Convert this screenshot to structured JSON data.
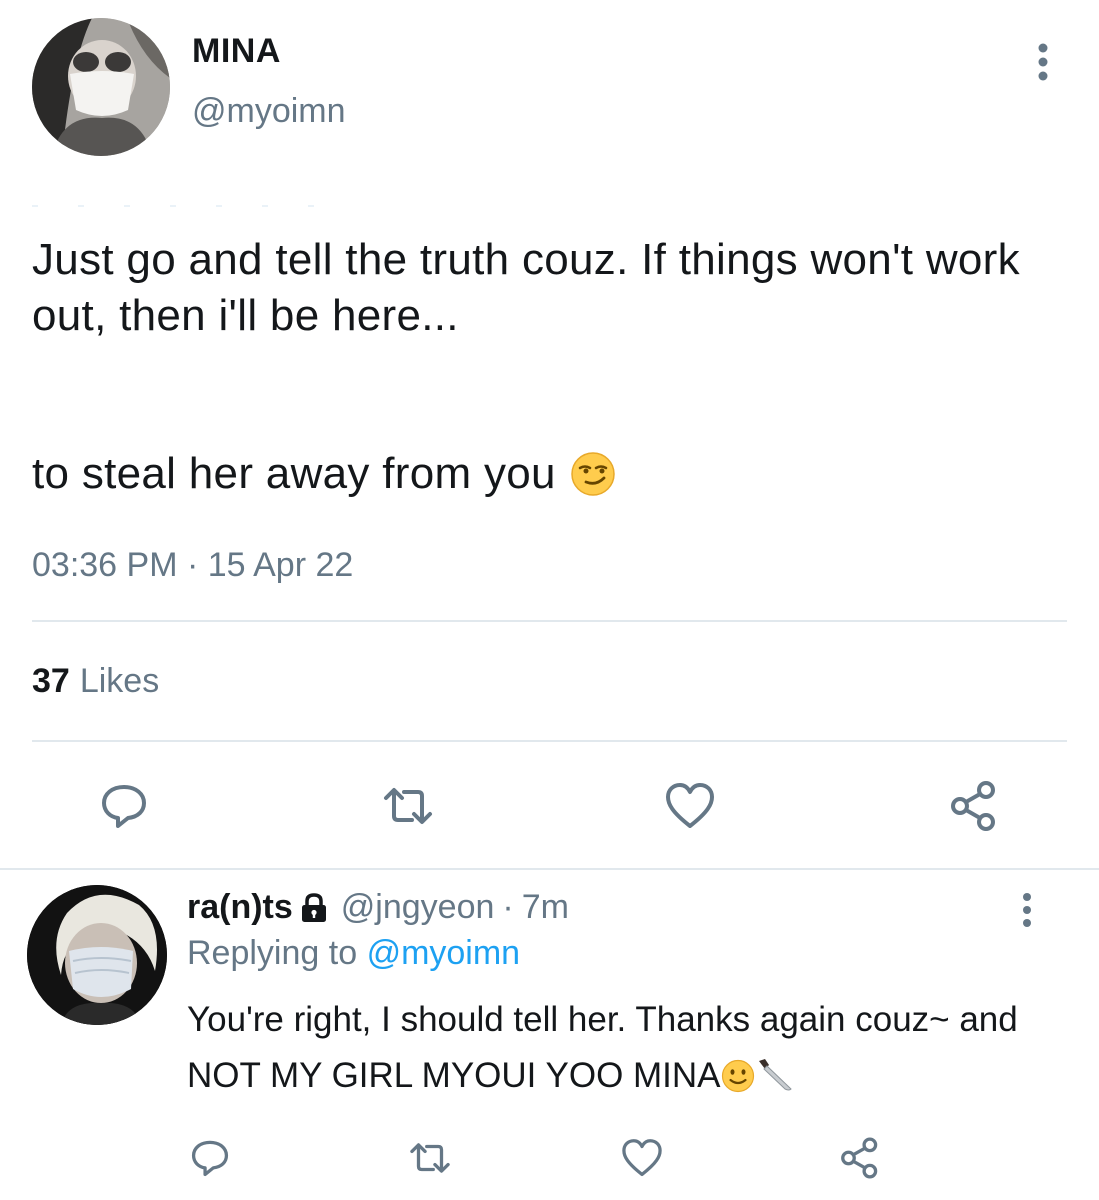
{
  "tweet": {
    "display_name": "MINA",
    "handle": "@myoimn",
    "text_line1": "Just go and tell the truth couz. If things won't work out, then i'll be here...",
    "text_line2": "to steal her away from you",
    "emoji": "smirking-face-emoji",
    "timestamp": "03:36 PM · 15 Apr 22",
    "likes_count": "37",
    "likes_label": "Likes",
    "actions": [
      "reply-icon",
      "retweet-icon",
      "like-icon",
      "share-icon"
    ]
  },
  "reply": {
    "display_name": "ra(n)ts",
    "protected_icon": "lock-icon",
    "handle": "@jngyeon",
    "separator": "·",
    "time": "7m",
    "replying_prefix": "Replying to",
    "replying_mention": "@myoimn",
    "text": "You're right, I should tell her. Thanks again couz~ and NOT MY GIRL MYOUI YOO MINA",
    "emojis": [
      "slightly-smiling-face-emoji",
      "knife-emoji"
    ],
    "actions": [
      "reply-icon",
      "retweet-icon",
      "like-icon",
      "share-icon"
    ]
  },
  "colors": {
    "text": "#14171a",
    "secondary": "#657786",
    "link": "#1da1f2",
    "divider": "#e1e8ed"
  }
}
